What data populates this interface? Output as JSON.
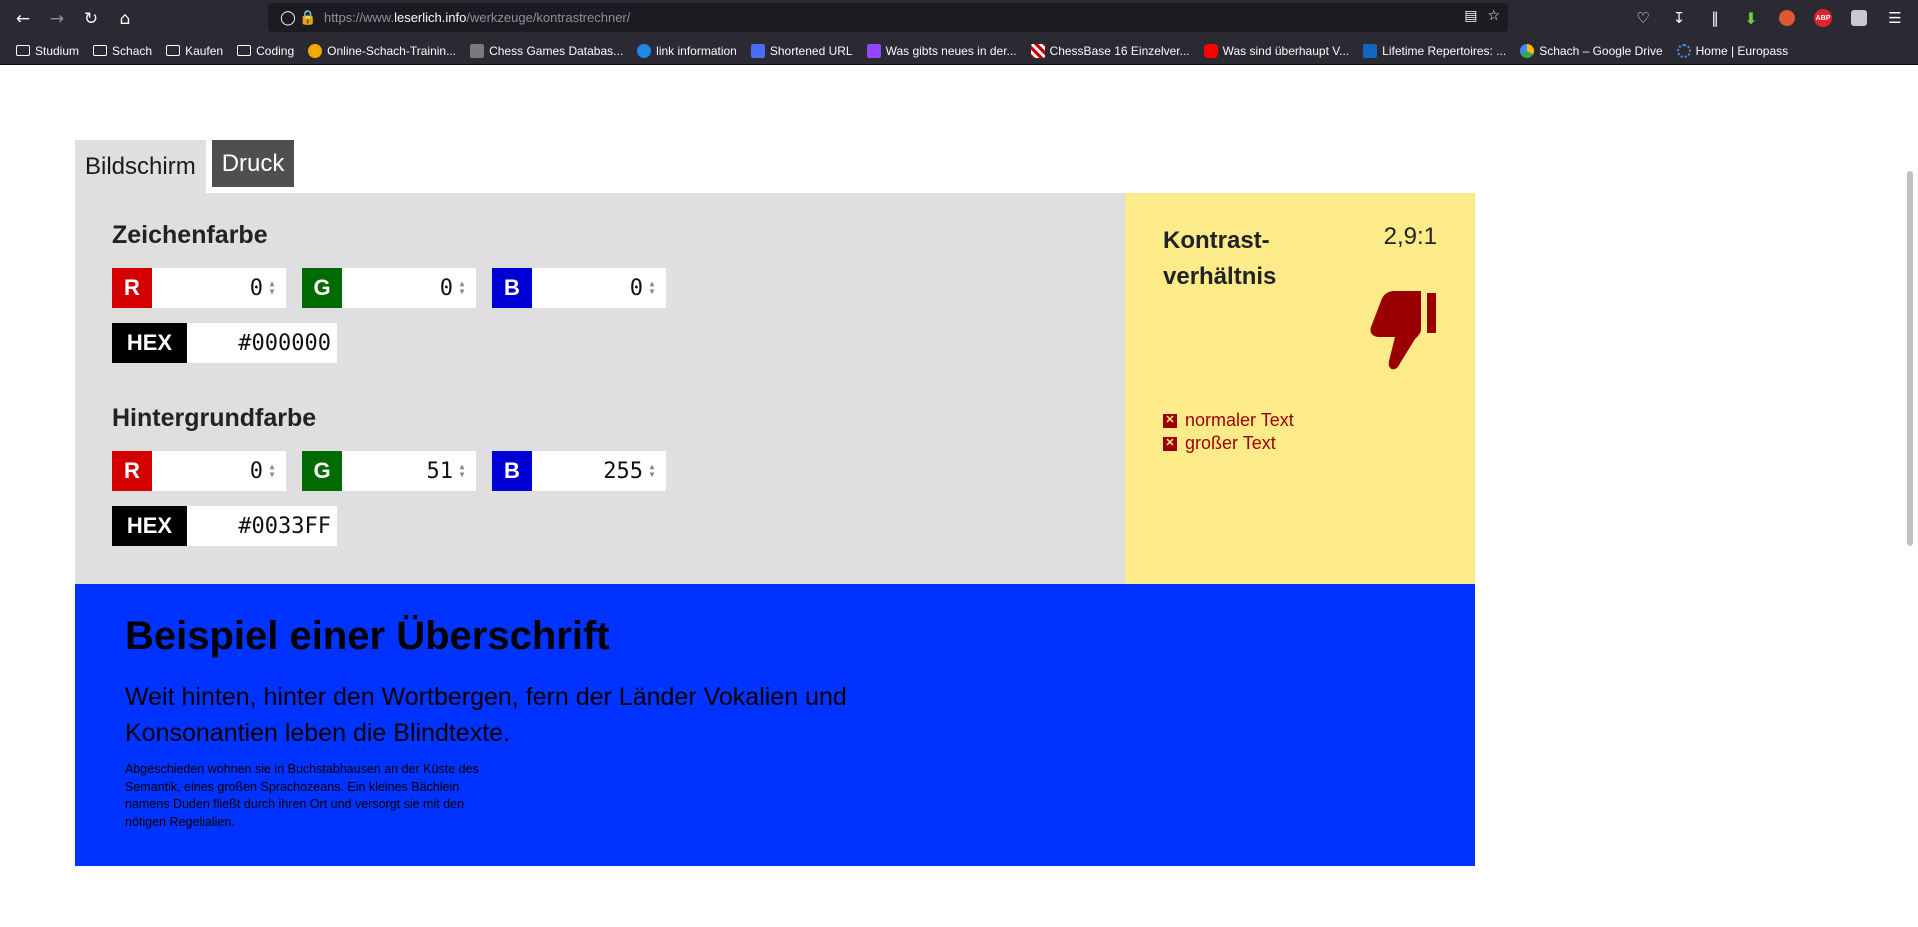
{
  "browser": {
    "url_prefix": "https://www.",
    "url_domain": "leserlich.info",
    "url_path": "/werkzeuge/kontrastrechner/",
    "bookmarks": [
      "Studium",
      "Schach",
      "Kaufen",
      "Coding",
      "Online-Schach-Trainin...",
      "Chess Games Databas...",
      "link information",
      "Shortened URL",
      "Was gibts neues in der...",
      "ChessBase 16 Einzelver...",
      "Was sind überhaupt V...",
      "Lifetime Repertoires: ...",
      "Schach – Google Drive",
      "Home | Europass"
    ],
    "abp_label": "ABP"
  },
  "tabs": {
    "screen": "Bildschirm",
    "print": "Druck"
  },
  "foreground": {
    "title": "Zeichenfarbe",
    "r_label": "R",
    "g_label": "G",
    "b_label": "B",
    "r": "0",
    "g": "0",
    "b": "0",
    "hex_label": "HEX",
    "hex": "#000000"
  },
  "background": {
    "title": "Hintergrundfarbe",
    "r_label": "R",
    "g_label": "G",
    "b_label": "B",
    "r": "0",
    "g": "51",
    "b": "255",
    "hex_label": "HEX",
    "hex": "#0033FF"
  },
  "result": {
    "label_line1": "Kontrast-",
    "label_line2": "verhältnis",
    "ratio": "2,9:1",
    "checks": [
      "normaler Text",
      "großer Text"
    ]
  },
  "preview": {
    "heading": "Beispiel einer Überschrift",
    "paragraph": "Weit hinten, hinter den Wortbergen, fern der Länder Vokalien und Konsonantien leben die Blindtexte.",
    "small": "Abgeschieden wohnen sie in Buchstabhausen an der Küste des Semantik, eines großen Sprachozeans. Ein kleines Bächlein namens Duden fließt durch ihren Ort und versorgt sie mit den nötigen Regelialien."
  },
  "colors": {
    "accent_red": "#d40000",
    "accent_green": "#006b00",
    "accent_blue": "#0000d4",
    "fail": "#9b0000",
    "result_bg": "#fdeb8a",
    "preview_bg": "#0033ff"
  }
}
